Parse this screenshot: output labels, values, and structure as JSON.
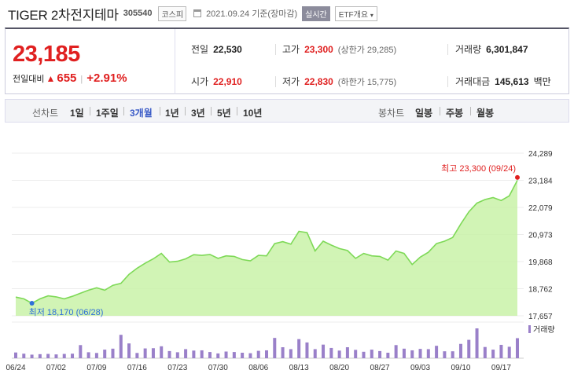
{
  "header": {
    "title": "TIGER 2차전지테마",
    "code": "305540",
    "market": "코스피",
    "date": "2021.09.24",
    "date_note": "기준(장마감)",
    "realtime_label": "실시간",
    "etf_label": "ETF개요"
  },
  "summary": {
    "price": "23,185",
    "change_label": "전일대비",
    "change_arrow": "▲",
    "change": "655",
    "change_rate": "+2.91%",
    "prev_close_label": "전일",
    "prev_close": "22,530",
    "high_label": "고가",
    "high": "23,300",
    "upper_limit_label": "(상한가 29,285)",
    "volume_label": "거래량",
    "volume": "6,301,847",
    "open_label": "시가",
    "open": "22,910",
    "low_label": "저가",
    "low": "22,830",
    "lower_limit_label": "(하한가 15,775)",
    "amount_label": "거래대금",
    "amount": "145,613",
    "amount_unit": "백만"
  },
  "tabs": {
    "line_label": "선차트",
    "line_tabs": [
      "1일",
      "1주일",
      "3개월",
      "1년",
      "3년",
      "5년",
      "10년"
    ],
    "active": "3개월",
    "candle_label": "봉차트",
    "candle_tabs": [
      "일봉",
      "주봉",
      "월봉"
    ]
  },
  "colors": {
    "up": "#e02020",
    "accent": "#3a5bc7",
    "line": "#7ed957",
    "fill": "#c9f2a8",
    "volume": "#9a80c9"
  },
  "chart_data": {
    "type": "area",
    "x_ticks": [
      "06/24",
      "07/02",
      "07/09",
      "07/16",
      "07/23",
      "07/30",
      "08/06",
      "08/13",
      "08/20",
      "08/27",
      "09/03",
      "09/10",
      "09/17"
    ],
    "y_ticks": [
      "24,289",
      "23,184",
      "22,079",
      "20,973",
      "19,868",
      "18,762",
      "17,657"
    ],
    "ylim": [
      17657,
      24289
    ],
    "prices": [
      18420,
      18350,
      18170,
      18350,
      18470,
      18430,
      18350,
      18450,
      18580,
      18700,
      18800,
      18700,
      18900,
      18980,
      19350,
      19600,
      19800,
      19980,
      20200,
      19850,
      19880,
      19980,
      20150,
      20120,
      20160,
      20000,
      20100,
      20080,
      19950,
      19900,
      20120,
      20100,
      20600,
      20680,
      20580,
      21100,
      21050,
      20300,
      20700,
      20540,
      20400,
      20320,
      20000,
      20200,
      20100,
      20080,
      19930,
      20300,
      20200,
      19750,
      20050,
      20250,
      20600,
      20700,
      20850,
      21400,
      21900,
      22250,
      22400,
      22480,
      22360,
      22550,
      23185
    ],
    "volume": [
      2.4,
      1.9,
      1.5,
      1.7,
      1.8,
      1.6,
      1.8,
      1.9,
      5.5,
      2.5,
      2.2,
      3.6,
      4.0,
      9.8,
      6.2,
      2.2,
      4.1,
      4.2,
      5.0,
      3.0,
      2.5,
      3.8,
      3.2,
      3.3,
      2.6,
      2.0,
      2.8,
      2.6,
      2.3,
      2.1,
      3.1,
      3.3,
      8.5,
      4.6,
      3.8,
      8.0,
      6.6,
      3.8,
      5.7,
      4.3,
      3.2,
      4.6,
      3.5,
      2.7,
      3.6,
      3.0,
      2.3,
      5.5,
      4.0,
      3.3,
      3.9,
      3.8,
      5.2,
      2.9,
      2.9,
      6.0,
      7.7,
      12.5,
      4.7,
      3.6,
      5.6,
      4.8,
      8.4
    ],
    "high_note": "최고 23,300 (09/24)",
    "high_value": 23300,
    "low_note": "최저 18,170 (06/28)",
    "low_value": 18170,
    "volume_legend": "거래량"
  }
}
